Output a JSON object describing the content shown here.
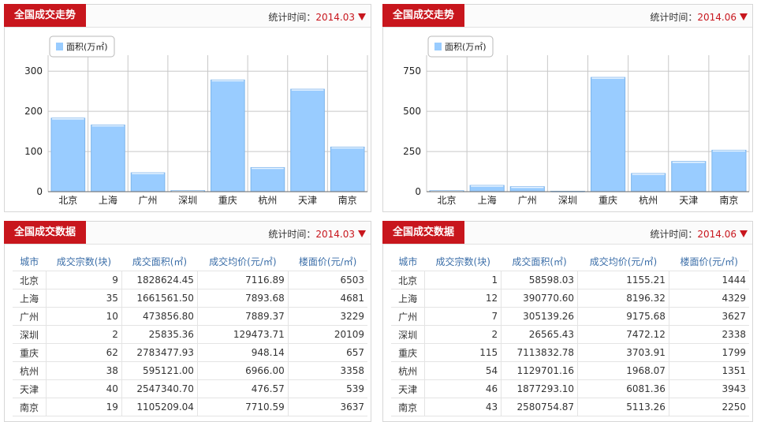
{
  "panels": {
    "chart1": {
      "title": "全国成交走势",
      "stat_label": "统计时间：",
      "stat_date": "2014.03"
    },
    "chart2": {
      "title": "全国成交走势",
      "stat_label": "统计时间：",
      "stat_date": "2014.06"
    },
    "table1": {
      "title": "全国成交数据",
      "stat_label": "统计时间：",
      "stat_date": "2014.03"
    },
    "table2": {
      "title": "全国成交数据",
      "stat_label": "统计时间：",
      "stat_date": "2014.06"
    }
  },
  "colors": {
    "accent": "#c8161d",
    "bar": "#99ccff",
    "header_text": "#3b6ea8"
  },
  "icons": {
    "dropdown": "down-triangle-icon"
  },
  "chart_data": [
    {
      "type": "bar",
      "categories": [
        "北京",
        "上海",
        "广州",
        "深圳",
        "重庆",
        "杭州",
        "天津",
        "南京"
      ],
      "series": [
        {
          "name": "面积(万㎡)",
          "values": [
            183,
            166,
            47,
            2.6,
            278,
            60,
            255,
            111
          ]
        }
      ],
      "yticks": [
        0,
        100,
        200,
        300
      ],
      "ylim": [
        0,
        320
      ],
      "grid": true,
      "legend": "top-left"
    },
    {
      "type": "bar",
      "categories": [
        "北京",
        "上海",
        "广州",
        "深圳",
        "重庆",
        "杭州",
        "天津",
        "南京"
      ],
      "series": [
        {
          "name": "面积(万㎡)",
          "values": [
            5.9,
            39,
            31,
            2.7,
            711,
            113,
            188,
            258
          ]
        }
      ],
      "yticks": [
        0,
        250,
        500,
        750
      ],
      "ylim": [
        0,
        800
      ],
      "grid": true,
      "legend": "top-left"
    }
  ],
  "tables": {
    "t1": {
      "headers": [
        "城市",
        "成交宗数(块)",
        "成交面积(㎡)",
        "成交均价(元/㎡)",
        "楼面价(元/㎡)"
      ],
      "rows": [
        [
          "北京",
          "9",
          "1828624.45",
          "7116.89",
          "6503"
        ],
        [
          "上海",
          "35",
          "1661561.50",
          "7893.68",
          "4681"
        ],
        [
          "广州",
          "10",
          "473856.80",
          "7889.37",
          "3229"
        ],
        [
          "深圳",
          "2",
          "25835.36",
          "129473.71",
          "20109"
        ],
        [
          "重庆",
          "62",
          "2783477.93",
          "948.14",
          "657"
        ],
        [
          "杭州",
          "38",
          "595121.00",
          "6966.00",
          "3358"
        ],
        [
          "天津",
          "40",
          "2547340.70",
          "476.57",
          "539"
        ],
        [
          "南京",
          "19",
          "1105209.04",
          "7710.59",
          "3637"
        ]
      ]
    },
    "t2": {
      "headers": [
        "城市",
        "成交宗数(块)",
        "成交面积(㎡)",
        "成交均价(元/㎡)",
        "楼面价(元/㎡)"
      ],
      "rows": [
        [
          "北京",
          "1",
          "58598.03",
          "1155.21",
          "1444"
        ],
        [
          "上海",
          "12",
          "390770.60",
          "8196.32",
          "4329"
        ],
        [
          "广州",
          "7",
          "305139.26",
          "9175.68",
          "3627"
        ],
        [
          "深圳",
          "2",
          "26565.43",
          "7472.12",
          "2338"
        ],
        [
          "重庆",
          "115",
          "7113832.78",
          "3703.91",
          "1799"
        ],
        [
          "杭州",
          "54",
          "1129701.16",
          "1968.07",
          "1351"
        ],
        [
          "天津",
          "46",
          "1877293.10",
          "6081.36",
          "3943"
        ],
        [
          "南京",
          "43",
          "2580754.87",
          "5113.26",
          "2250"
        ]
      ]
    }
  }
}
